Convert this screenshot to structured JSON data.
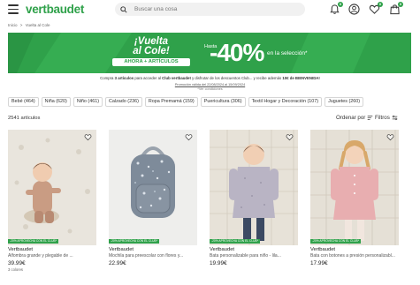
{
  "header": {
    "logo": "vertbaudet",
    "search_placeholder": "Buscar una cosa",
    "badges": {
      "notifications": "0",
      "wishlist": "0",
      "cart": "0"
    }
  },
  "breadcrumb": [
    "Inicio",
    ">",
    "Vuelta al Cole"
  ],
  "banner": {
    "title_line1": "¡Vuelta",
    "title_line2": "al Cole!",
    "subtitle": "AHORA + ARTÍCULOS",
    "hasta": "Hasta",
    "discount": "-40%",
    "selection": "en la selección*",
    "background_color": "#2fa14a"
  },
  "promo": {
    "line1_a": "Compra",
    "line1_b": "3 artículos",
    "line1_c": "para acceder al",
    "line1_club": "Club vertbaudet",
    "line1_d": "y disfrutar de los descuentos Club... y recibe además",
    "line1_e": "10€ de BIENVENIDA!",
    "line2": "Promoción válida del 22/08/2024 al 15/09/2024",
    "line3": "*Ver condiciones"
  },
  "chips": [
    "Bebé (464)",
    "Niña (620)",
    "Niño (461)",
    "Calzado (236)",
    "Ropa Premamá (159)",
    "Puericultura (306)",
    "Textil Hogar y Decoración (107)",
    "Juguetes (260)"
  ],
  "results": {
    "count": "2541 artículos",
    "sort_label": "Ordenar por",
    "filters_label": "Filtros"
  },
  "products": [
    {
      "badge": "-20% APROVECHA CON EL CLUB*",
      "brand": "Vertbaudet",
      "name": "Alfombra grande y plegable de ...",
      "price": "39.99€",
      "colors": "3 colores"
    },
    {
      "badge": "-20% APROVECHA CON EL CLUB*",
      "brand": "Vertbaudet",
      "name": "Mochila para preescolar con flores y...",
      "price": "22.99€",
      "colors": ""
    },
    {
      "badge": "-20% APROVECHA CON EL CLUB*",
      "brand": "Vertbaudet",
      "name": "Bata personalizable para niño - lila...",
      "price": "19.99€",
      "colors": ""
    },
    {
      "badge": "-20% APROVECHA CON EL CLUB*",
      "brand": "Vertbaudet",
      "name": "Bata con botones a presión personalizabl...",
      "price": "17.99€",
      "colors": ""
    }
  ]
}
